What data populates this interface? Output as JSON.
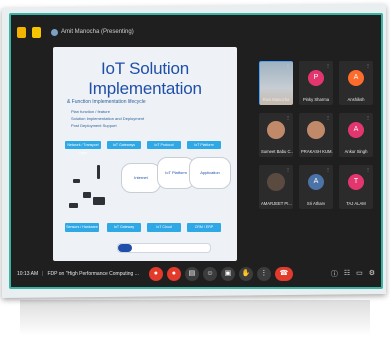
{
  "top_bar": {
    "presenter_label": "Amit Manocha (Presenting)"
  },
  "slide": {
    "title": "IoT Solution Implementation",
    "subtitle": "& Function Implementation lifecycle",
    "bullets": [
      "Plan function / feature",
      "Solution Implementation and Deployment",
      "Post Deployment Support"
    ],
    "lane_buttons": [
      "Network / Transport Layer",
      "IoT Gateways",
      "IoT Protocol",
      "IoT Platform"
    ],
    "cloud_labels": [
      "Internet",
      "IoT Platform",
      "Application"
    ],
    "footer_buttons": [
      "Sensors / Hardware",
      "IoT Gateway",
      "IoT Cloud",
      "CRM / ERP"
    ],
    "video_progress": 0.15
  },
  "participants": [
    {
      "name": "Ravi Manocha",
      "initial": "",
      "color": "",
      "kind": "live"
    },
    {
      "name": "Pinky Sharma",
      "initial": "P",
      "color": "#e3366f",
      "kind": "initial"
    },
    {
      "name": "Anshiksh",
      "initial": "A",
      "color": "#ff6b2c",
      "kind": "initial"
    },
    {
      "name": "Sumeet Babu C...",
      "initial": "",
      "color": "",
      "kind": "photo"
    },
    {
      "name": "PRAKASH KUM...",
      "initial": "",
      "color": "",
      "kind": "photo"
    },
    {
      "name": "Ankur Singh",
      "initial": "A",
      "color": "#e3366f",
      "kind": "initial"
    },
    {
      "name": "AMARJEET PI...",
      "initial": "",
      "color": "",
      "kind": "photo-dark"
    },
    {
      "name": "Sri Atharv",
      "initial": "A",
      "color": "#4b73a8",
      "kind": "initial"
    },
    {
      "name": "TAJ ALAM",
      "initial": "T",
      "color": "#e3366f",
      "kind": "initial"
    }
  ],
  "bottom_bar": {
    "time": "10:13 AM",
    "meeting_title": "FDP on \"High Performance Computing ..."
  },
  "icons": {
    "mic": "mic-icon",
    "camera": "camera-icon",
    "captions": "captions-icon",
    "present": "present-icon",
    "reactions": "raise-hand-icon",
    "more": "more-icon",
    "end": "end-call-icon",
    "info": "info-icon",
    "people": "people-icon",
    "chat": "chat-icon",
    "activities": "activities-icon"
  },
  "colors": {
    "accent_blue": "#2fa8e6",
    "end_call_red": "#e23a2b",
    "frame_teal": "#3bb3a3"
  }
}
